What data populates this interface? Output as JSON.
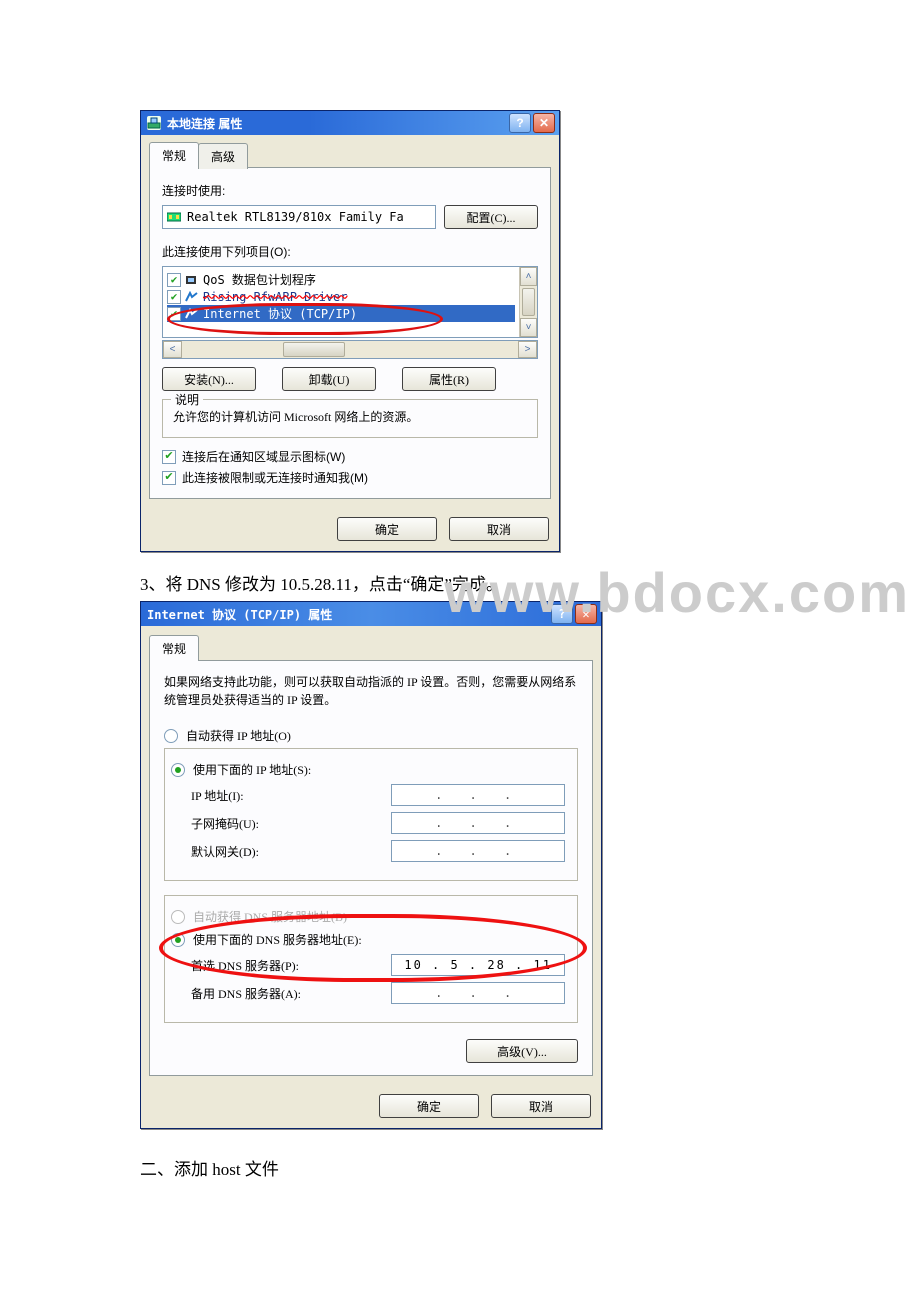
{
  "dialog1": {
    "title": "本地连接  属性",
    "tabs": {
      "general": "常规",
      "advanced": "高级"
    },
    "label_connect_using": "连接时使用:",
    "device_name": "Realtek RTL8139/810x Family Fa",
    "config_btn": "配置(C)...",
    "label_items": "此连接使用下列项目(O):",
    "items": {
      "qos": "QoS 数据包计划程序",
      "rising": "Rising RfwARP Driver",
      "tcpip": "Internet 协议 (TCP/IP)"
    },
    "buttons": {
      "install": "安装(N)...",
      "uninstall": "卸载(U)",
      "properties": "属性(R)"
    },
    "desc_legend": "说明",
    "desc_text": "允许您的计算机访问 Microsoft 网络上的资源。",
    "chk_showicon": "连接后在通知区域显示图标(W)",
    "chk_notify": "此连接被限制或无连接时通知我(M)",
    "ok": "确定",
    "cancel": "取消"
  },
  "step3": "3、将 DNS 修改为 10.5.28.11，点击“确定”完成。",
  "watermark": "www.bdocx.com",
  "dialog2": {
    "title": "Internet 协议 (TCP/IP) 属性",
    "tab_general": "常规",
    "info": "如果网络支持此功能，则可以获取自动指派的 IP 设置。否则，您需要从网络系统管理员处获得适当的 IP 设置。",
    "radio_auto_ip": "自动获得 IP 地址(O)",
    "radio_use_ip": "使用下面的 IP 地址(S):",
    "ip_label": "IP 地址(I):",
    "subnet_label": "子网掩码(U):",
    "gateway_label": "默认网关(D):",
    "radio_auto_dns": "自动获得 DNS 服务器地址(B)",
    "radio_use_dns": "使用下面的 DNS 服务器地址(E):",
    "pref_dns_label": "首选 DNS 服务器(P):",
    "pref_dns_value": "10 . 5 . 28 . 11",
    "alt_dns_label": "备用 DNS 服务器(A):",
    "advanced_btn": "高级(V)...",
    "ok": "确定",
    "cancel": "取消"
  },
  "section2": "二、添加 host 文件"
}
